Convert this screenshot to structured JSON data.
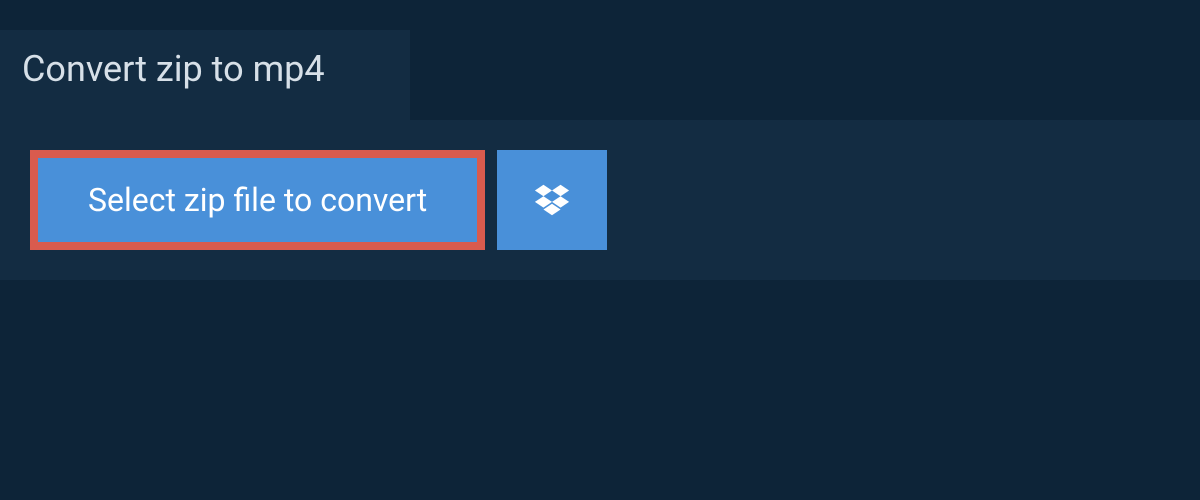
{
  "header": {
    "title": "Convert zip to mp4"
  },
  "actions": {
    "select_file_label": "Select zip file to convert",
    "dropbox_icon": "dropbox-icon"
  },
  "colors": {
    "background": "#0d2438",
    "panel": "#132c42",
    "button": "#4990d9",
    "highlight_border": "#d95b4e",
    "text_light": "#d7e0e8",
    "text_white": "#ffffff"
  }
}
